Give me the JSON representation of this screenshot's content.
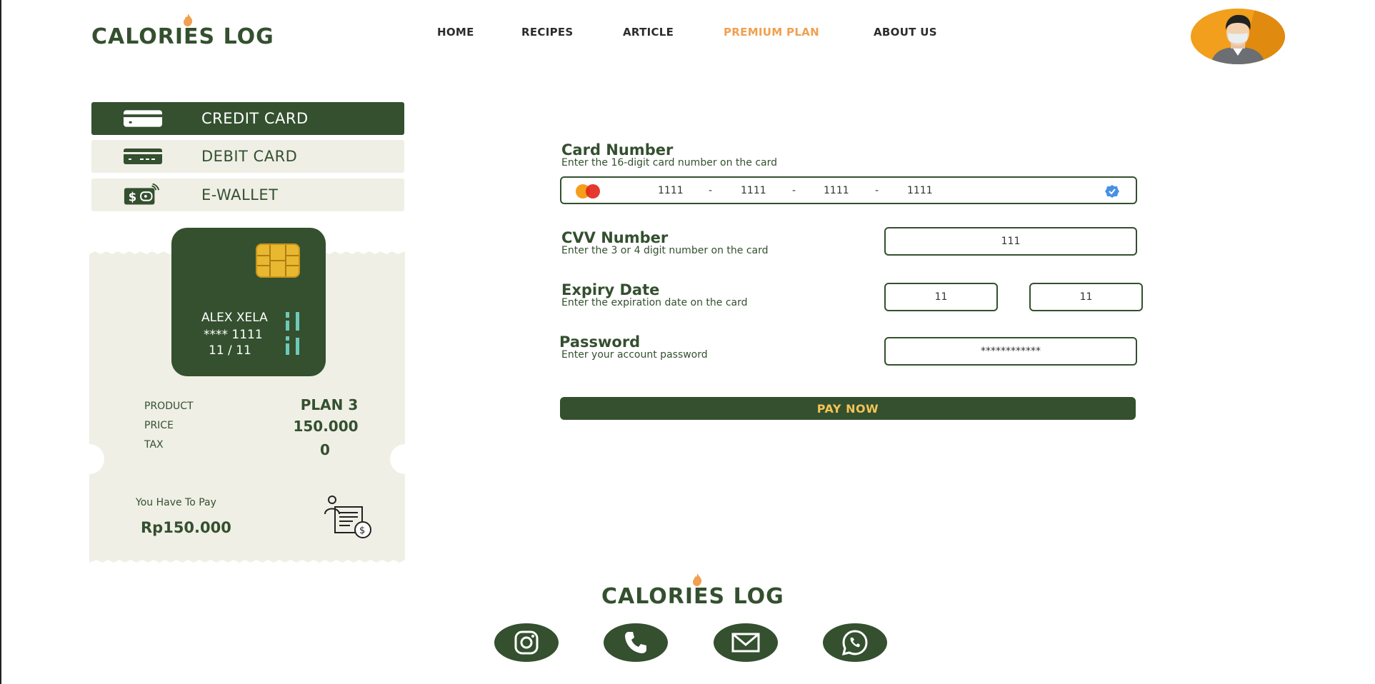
{
  "brand": {
    "name": "CALORIES LOG"
  },
  "nav": {
    "items": [
      {
        "label": "HOME"
      },
      {
        "label": "RECIPES"
      },
      {
        "label": "ARTICLE"
      },
      {
        "label": "PREMIUM PLAN",
        "active": true
      },
      {
        "label": "ABOUT US"
      }
    ]
  },
  "payment_methods": [
    {
      "label": "CREDIT CARD",
      "icon": "credit-card-icon",
      "active": true
    },
    {
      "label": "DEBIT CARD",
      "icon": "debit-card-icon"
    },
    {
      "label": "E-WALLET",
      "icon": "e-wallet-icon"
    }
  ],
  "card_preview": {
    "name": "ALEX XELA",
    "number": "**** 1111",
    "expiry": "11 / 11"
  },
  "summary": {
    "product_label": "PRODUCT",
    "product_value": "PLAN 3",
    "price_label": "PRICE",
    "price_value": "150.000",
    "tax_label": "TAX",
    "tax_value": "0",
    "total_label": "You Have To Pay",
    "total_value": "Rp150.000"
  },
  "form": {
    "card_number": {
      "title": "Card Number",
      "subtitle": "Enter the 16-digit card number on the card",
      "segments": [
        "1111",
        "1111",
        "1111",
        "1111"
      ],
      "separator": "-"
    },
    "cvv": {
      "title": "CVV Number",
      "subtitle": "Enter the 3 or 4 digit number on the card",
      "value": "111"
    },
    "expiry": {
      "title": "Expiry Date",
      "subtitle": "Enter the expiration date on the card",
      "month": "11",
      "year": "11"
    },
    "password": {
      "title": "Password",
      "subtitle": "Enter your account password",
      "value": "************"
    },
    "submit_label": "PAY NOW"
  },
  "footer": {
    "brand": "CALORIES LOG",
    "social": [
      "instagram-icon",
      "phone-icon",
      "mail-icon",
      "whatsapp-icon"
    ]
  },
  "colors": {
    "primary": "#34502f",
    "accent": "#f0a050",
    "button_text": "#f3c456",
    "panel_bg": "#efefe6",
    "avatar_bg": "#f19f1c"
  }
}
